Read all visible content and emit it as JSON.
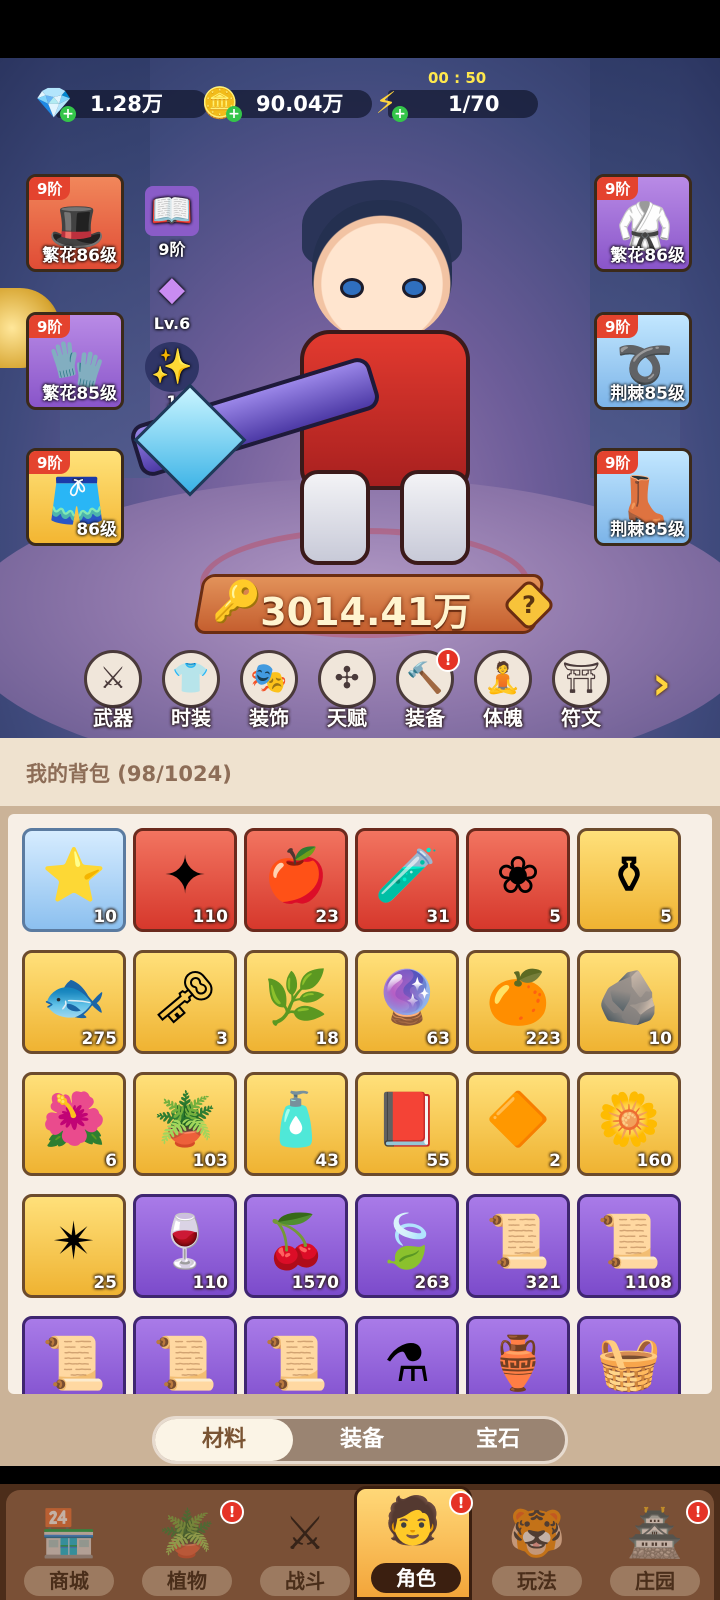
{
  "currencies": {
    "gems": {
      "value": "1.28万",
      "icon": "diamond-icon"
    },
    "coins": {
      "value": "90.04万",
      "icon": "coin-icon"
    },
    "energy": {
      "value": "1/70",
      "icon": "lightning-icon",
      "timer": "00 : 50"
    }
  },
  "left_slots": [
    {
      "tier": "9阶",
      "level": "繁花86级",
      "icon": "hat-icon",
      "rarity": "red"
    },
    {
      "tier": "9阶",
      "level": "繁花85级",
      "icon": "glove-icon",
      "rarity": "purple"
    },
    {
      "tier": "9阶",
      "level": "86级",
      "icon": "pants-icon",
      "rarity": "gold"
    }
  ],
  "right_slots": [
    {
      "tier": "9阶",
      "level": "繁花86级",
      "icon": "armor-icon",
      "rarity": "purple"
    },
    {
      "tier": "9阶",
      "level": "荆棘85级",
      "icon": "belt-icon",
      "rarity": "blue"
    },
    {
      "tier": "9阶",
      "level": "荆棘85级",
      "icon": "boots-icon",
      "rarity": "blue"
    }
  ],
  "mini_items": {
    "book": {
      "label": "9阶",
      "icon": "spellbook-icon"
    },
    "crystal": {
      "label": "Lv.6",
      "icon": "crystal-icon"
    },
    "orb": {
      "label": "1",
      "icon": "orb-icon"
    }
  },
  "power": {
    "value": "3014.41万"
  },
  "functions": [
    {
      "label": "武器",
      "icon": "weapon-icon"
    },
    {
      "label": "时装",
      "icon": "outfit-icon"
    },
    {
      "label": "装饰",
      "icon": "mask-icon"
    },
    {
      "label": "天赋",
      "icon": "talent-icon"
    },
    {
      "label": "装备",
      "icon": "equipment-icon",
      "badge": "!"
    },
    {
      "label": "体魄",
      "icon": "physique-icon"
    },
    {
      "label": "符文",
      "icon": "rune-icon"
    }
  ],
  "bag": {
    "title": "我的背包 (98/1024)",
    "items": [
      {
        "count": "10",
        "rarity": "blue",
        "icon": "star-badge-icon"
      },
      {
        "count": "110",
        "rarity": "red",
        "icon": "blue-star-icon"
      },
      {
        "count": "23",
        "rarity": "red",
        "icon": "red-potion-icon"
      },
      {
        "count": "31",
        "rarity": "red",
        "icon": "green-capsule-icon"
      },
      {
        "count": "5",
        "rarity": "red",
        "icon": "knot-icon"
      },
      {
        "count": "5",
        "rarity": "gold",
        "icon": "gold-flask-icon"
      },
      {
        "count": "275",
        "rarity": "gold",
        "icon": "goldfish-icon"
      },
      {
        "count": "3",
        "rarity": "gold",
        "icon": "key-icon"
      },
      {
        "count": "18",
        "rarity": "gold",
        "icon": "leaf-bud-icon"
      },
      {
        "count": "63",
        "rarity": "gold",
        "icon": "rune-stone-icon"
      },
      {
        "count": "223",
        "rarity": "gold",
        "icon": "orange-potion-icon"
      },
      {
        "count": "10",
        "rarity": "gold",
        "icon": "ore-icon"
      },
      {
        "count": "6",
        "rarity": "gold",
        "icon": "red-flower-icon"
      },
      {
        "count": "103",
        "rarity": "gold",
        "icon": "flower-pot-icon"
      },
      {
        "count": "43",
        "rarity": "gold",
        "icon": "sprayer-icon"
      },
      {
        "count": "55",
        "rarity": "gold",
        "icon": "purple-book-icon"
      },
      {
        "count": "2",
        "rarity": "gold",
        "icon": "orange-gem-icon"
      },
      {
        "count": "160",
        "rarity": "gold",
        "icon": "gold-lily-icon"
      },
      {
        "count": "25",
        "rarity": "gold",
        "icon": "gold-knot-icon"
      },
      {
        "count": "110",
        "rarity": "purple",
        "icon": "purple-potion-icon"
      },
      {
        "count": "1570",
        "rarity": "purple",
        "icon": "candied-fruit-icon"
      },
      {
        "count": "263",
        "rarity": "purple",
        "icon": "cyan-leaf-icon"
      },
      {
        "count": "321",
        "rarity": "purple",
        "icon": "green-scroll-icon"
      },
      {
        "count": "1108",
        "rarity": "purple",
        "icon": "purple-scroll-icon"
      },
      {
        "count": "",
        "rarity": "purple",
        "icon": "blue-scroll-icon"
      },
      {
        "count": "",
        "rarity": "purple",
        "icon": "red-scroll-icon"
      },
      {
        "count": "",
        "rarity": "purple",
        "icon": "gold-scroll-icon"
      },
      {
        "count": "",
        "rarity": "purple",
        "icon": "potion-icon"
      },
      {
        "count": "",
        "rarity": "purple",
        "icon": "vase-icon"
      },
      {
        "count": "",
        "rarity": "purple",
        "icon": "fruit-basket-icon"
      }
    ]
  },
  "tabs": [
    {
      "label": "材料",
      "active": true
    },
    {
      "label": "装备",
      "active": false
    },
    {
      "label": "宝石",
      "active": false
    }
  ],
  "nav": [
    {
      "label": "商城",
      "icon": "shop-icon",
      "badge": ""
    },
    {
      "label": "植物",
      "icon": "plant-icon",
      "badge": "!"
    },
    {
      "label": "战斗",
      "icon": "battle-icon",
      "badge": ""
    },
    {
      "label": "角色",
      "icon": "character-icon",
      "badge": "!",
      "active": true
    },
    {
      "label": "玩法",
      "icon": "gameplay-icon",
      "badge": ""
    },
    {
      "label": "庄园",
      "icon": "manor-icon",
      "badge": "!"
    }
  ],
  "colors": {
    "accent": "#f3a53a",
    "badge": "#e53326",
    "power_banner": "#d3703d"
  }
}
